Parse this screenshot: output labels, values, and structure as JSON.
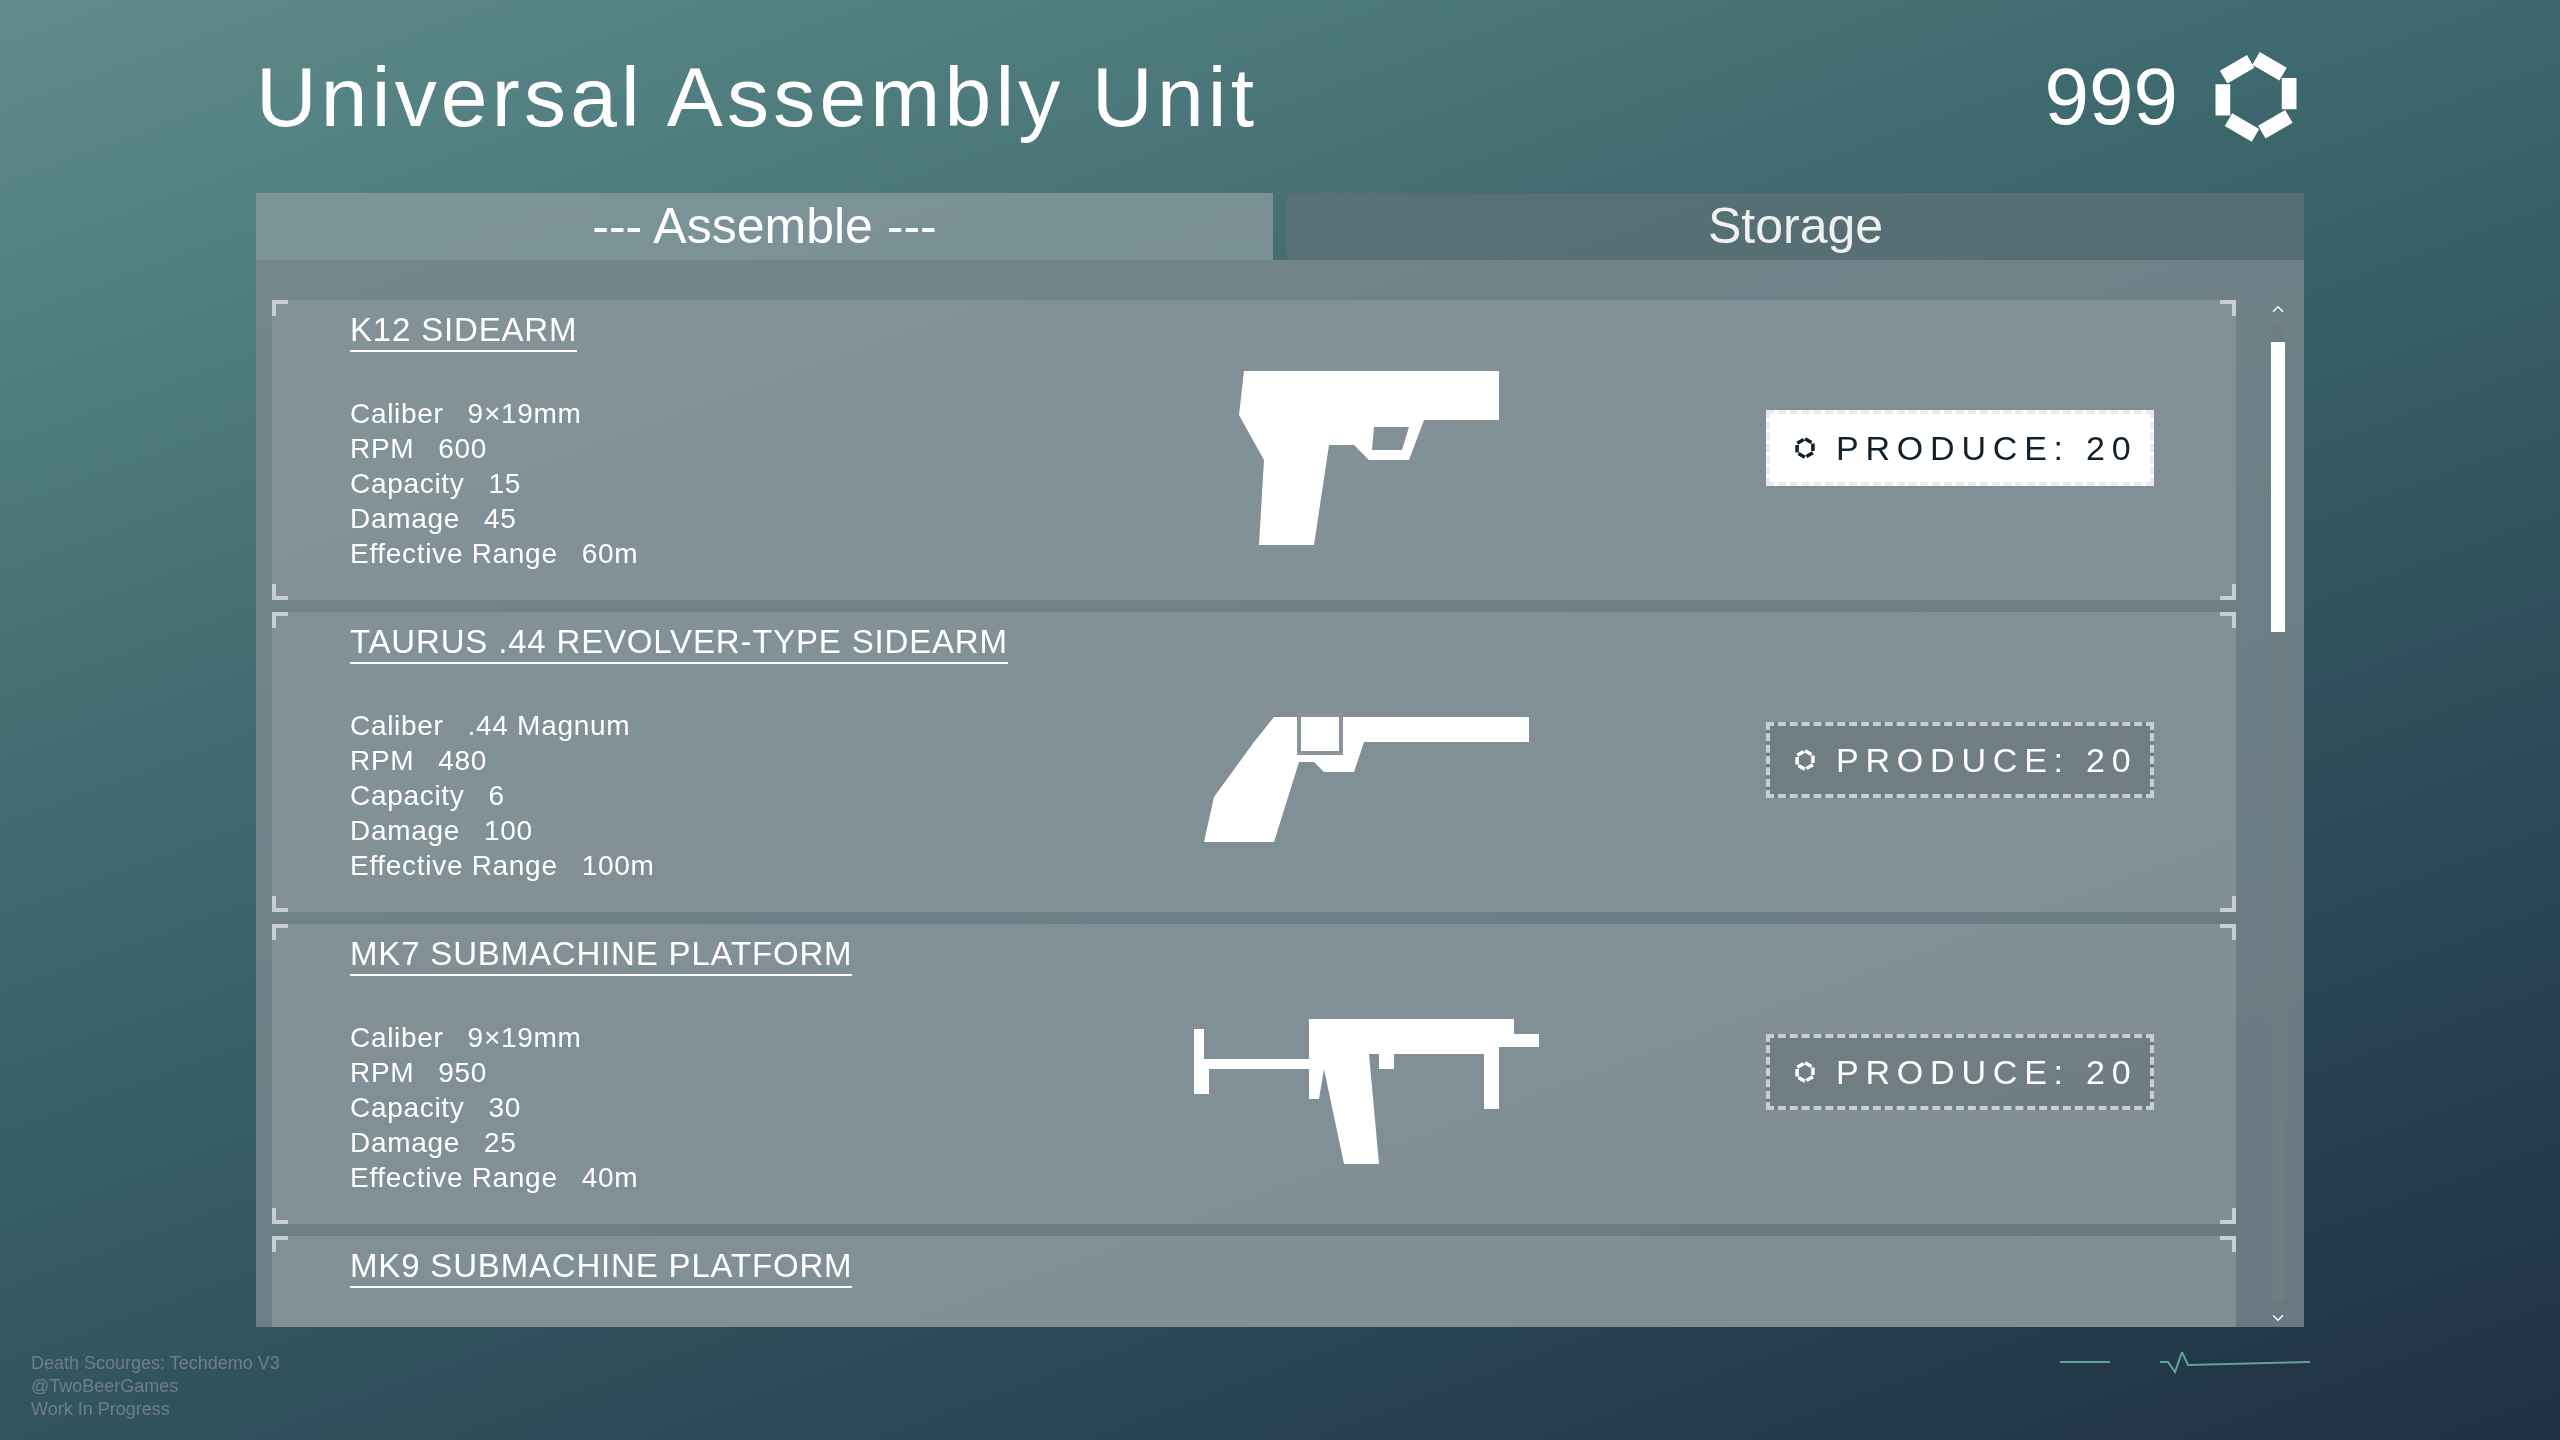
{
  "title": "Universal Assembly Unit",
  "currency": {
    "amount": "999"
  },
  "tabs": [
    {
      "label": "--- Assemble ---",
      "selected": true
    },
    {
      "label": "Storage",
      "selected": false
    }
  ],
  "items": [
    {
      "kind": "pistol",
      "name": "K12 SIDEARM",
      "stats": [
        {
          "label": "Caliber",
          "value": "9×19mm"
        },
        {
          "label": "RPM",
          "value": "600"
        },
        {
          "label": "Capacity",
          "value": "15"
        },
        {
          "label": "Damage",
          "value": "45"
        },
        {
          "label": "Effective Range",
          "value": "60m"
        }
      ],
      "button": {
        "label": "PRODUCE: 20",
        "highlighted": true
      }
    },
    {
      "kind": "revolver",
      "name": "TAURUS .44 REVOLVER-TYPE SIDEARM",
      "stats": [
        {
          "label": "Caliber",
          "value": ".44 Magnum"
        },
        {
          "label": "RPM",
          "value": "480"
        },
        {
          "label": "Capacity",
          "value": "6"
        },
        {
          "label": "Damage",
          "value": "100"
        },
        {
          "label": "Effective Range",
          "value": "100m"
        }
      ],
      "button": {
        "label": "PRODUCE: 20",
        "highlighted": false
      }
    },
    {
      "kind": "smg",
      "name": "MK7 SUBMACHINE PLATFORM",
      "stats": [
        {
          "label": "Caliber",
          "value": "9×19mm"
        },
        {
          "label": "RPM",
          "value": "950"
        },
        {
          "label": "Capacity",
          "value": "30"
        },
        {
          "label": "Damage",
          "value": "25"
        },
        {
          "label": "Effective Range",
          "value": "40m"
        }
      ],
      "button": {
        "label": "PRODUCE: 20",
        "highlighted": false
      }
    },
    {
      "name": "MK9 SUBMACHINE PLATFORM"
    }
  ],
  "footer": [
    "Death Scourges: Techdemo V3",
    "@TwoBeerGames",
    "Work In Progress"
  ]
}
